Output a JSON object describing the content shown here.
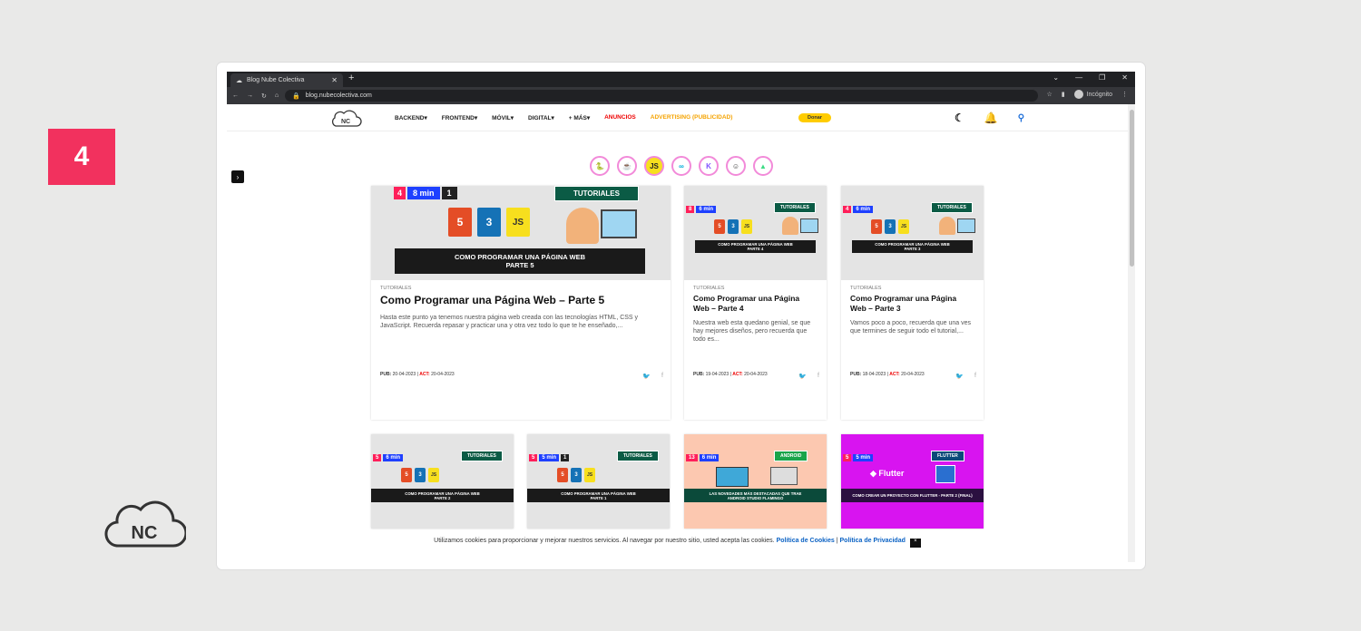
{
  "step_number": "4",
  "browser": {
    "tab_title": "Blog Nube Colectiva",
    "url": "blog.nubecolectiva.com",
    "incognito_label": "Incógnito"
  },
  "site": {
    "logo_text": "NC",
    "menu": [
      "BACKEND▾",
      "FRONTEND▾",
      "MÓVIL▾",
      "DIGITAL▾",
      "+ MÁS▾",
      "ANUNCIOS",
      "ADVERTISING (PUBLICIDAD)"
    ],
    "donate": "Donar"
  },
  "categories": [
    "py",
    "java",
    "JS",
    "go",
    "K",
    "git",
    "android"
  ],
  "featured": {
    "badges": [
      "4",
      "8 min",
      "1"
    ],
    "ribbon": "TUTORIALES",
    "banner": "COMO PROGRAMAR UNA PÁGINA WEB\nPARTE 5",
    "kicker": "TUTORIALES",
    "title": "Como Programar una Página Web – Parte 5",
    "excerpt": "Hasta este punto ya tenemos nuestra página web creada con las tecnologías HTML, CSS y JavaScript. Recuerda repasar y practicar una y otra vez todo lo que te he enseñado,...",
    "pub": "20-04-2023",
    "act": "20-04-2023"
  },
  "posts": [
    {
      "badges": [
        "8",
        "6 min"
      ],
      "ribbon": "TUTORIALES",
      "banner": "COMO PROGRAMAR UNA PÁGINA WEB\nPARTE 4",
      "kicker": "TUTORIALES",
      "title": "Como Programar una Página Web – Parte 4",
      "excerpt": "Nuestra web esta quedano genial, se que hay mejores diseños, pero recuerda que todo es...",
      "pub": "19-04-2023",
      "act": "20-04-2023"
    },
    {
      "badges": [
        "4",
        "6 min"
      ],
      "ribbon": "TUTORIALES",
      "banner": "COMO PROGRAMAR UNA PÁGINA WEB\nPARTE 3",
      "kicker": "TUTORIALES",
      "title": "Como Programar una Página Web – Parte 3",
      "excerpt": "Vamos poco a poco, recuerda que una ves que termines de seguir todo el tutorial,...",
      "pub": "18-04-2023",
      "act": "20-04-2023"
    }
  ],
  "row2": [
    {
      "badges": [
        "5",
        "6 min"
      ],
      "ribbon": "TUTORIALES",
      "banner": "COMO PROGRAMAR UNA PÁGINA WEB\nPARTE 2",
      "bg": "#e4e4e4",
      "ribbon_color": "#0b5b45"
    },
    {
      "badges": [
        "5",
        "5 min",
        "1"
      ],
      "ribbon": "TUTORIALES",
      "banner": "COMO PROGRAMAR UNA PÁGINA WEB\nPARTE 1",
      "bg": "#e4e4e4",
      "ribbon_color": "#0b5b45"
    },
    {
      "badges": [
        "13",
        "6 min"
      ],
      "ribbon": "ANDROID",
      "banner": "LAS NOVEDADES MÁS DESTACADAS QUE TRAE\nANDROID STUDIO FLAMINGO",
      "bg": "#fcc8b0",
      "ribbon_color": "#1aa44a"
    },
    {
      "badges": [
        "5",
        "5 min"
      ],
      "ribbon": "FLUTTER",
      "banner": "COMO CREAR UN PROYECTO CON FLUTTER - PARTE 2 (FINAL)",
      "bg": "#d814f0",
      "ribbon_color": "#0b4a7a"
    }
  ],
  "labels": {
    "pub": "PUB:",
    "act": "ACT:"
  },
  "cookie": {
    "text": "Utilizamos cookies para proporcionar y mejorar nuestros servicios. Al navegar por nuestro sitio, usted acepta las cookies.",
    "cookies_link": "Política de Cookies",
    "sep": " | ",
    "privacy_link": "Política de Privacidad",
    "close": "×"
  },
  "colors": {
    "accent": "#f2315e",
    "link": "#0b62c4",
    "donate": "#ffcc00"
  }
}
